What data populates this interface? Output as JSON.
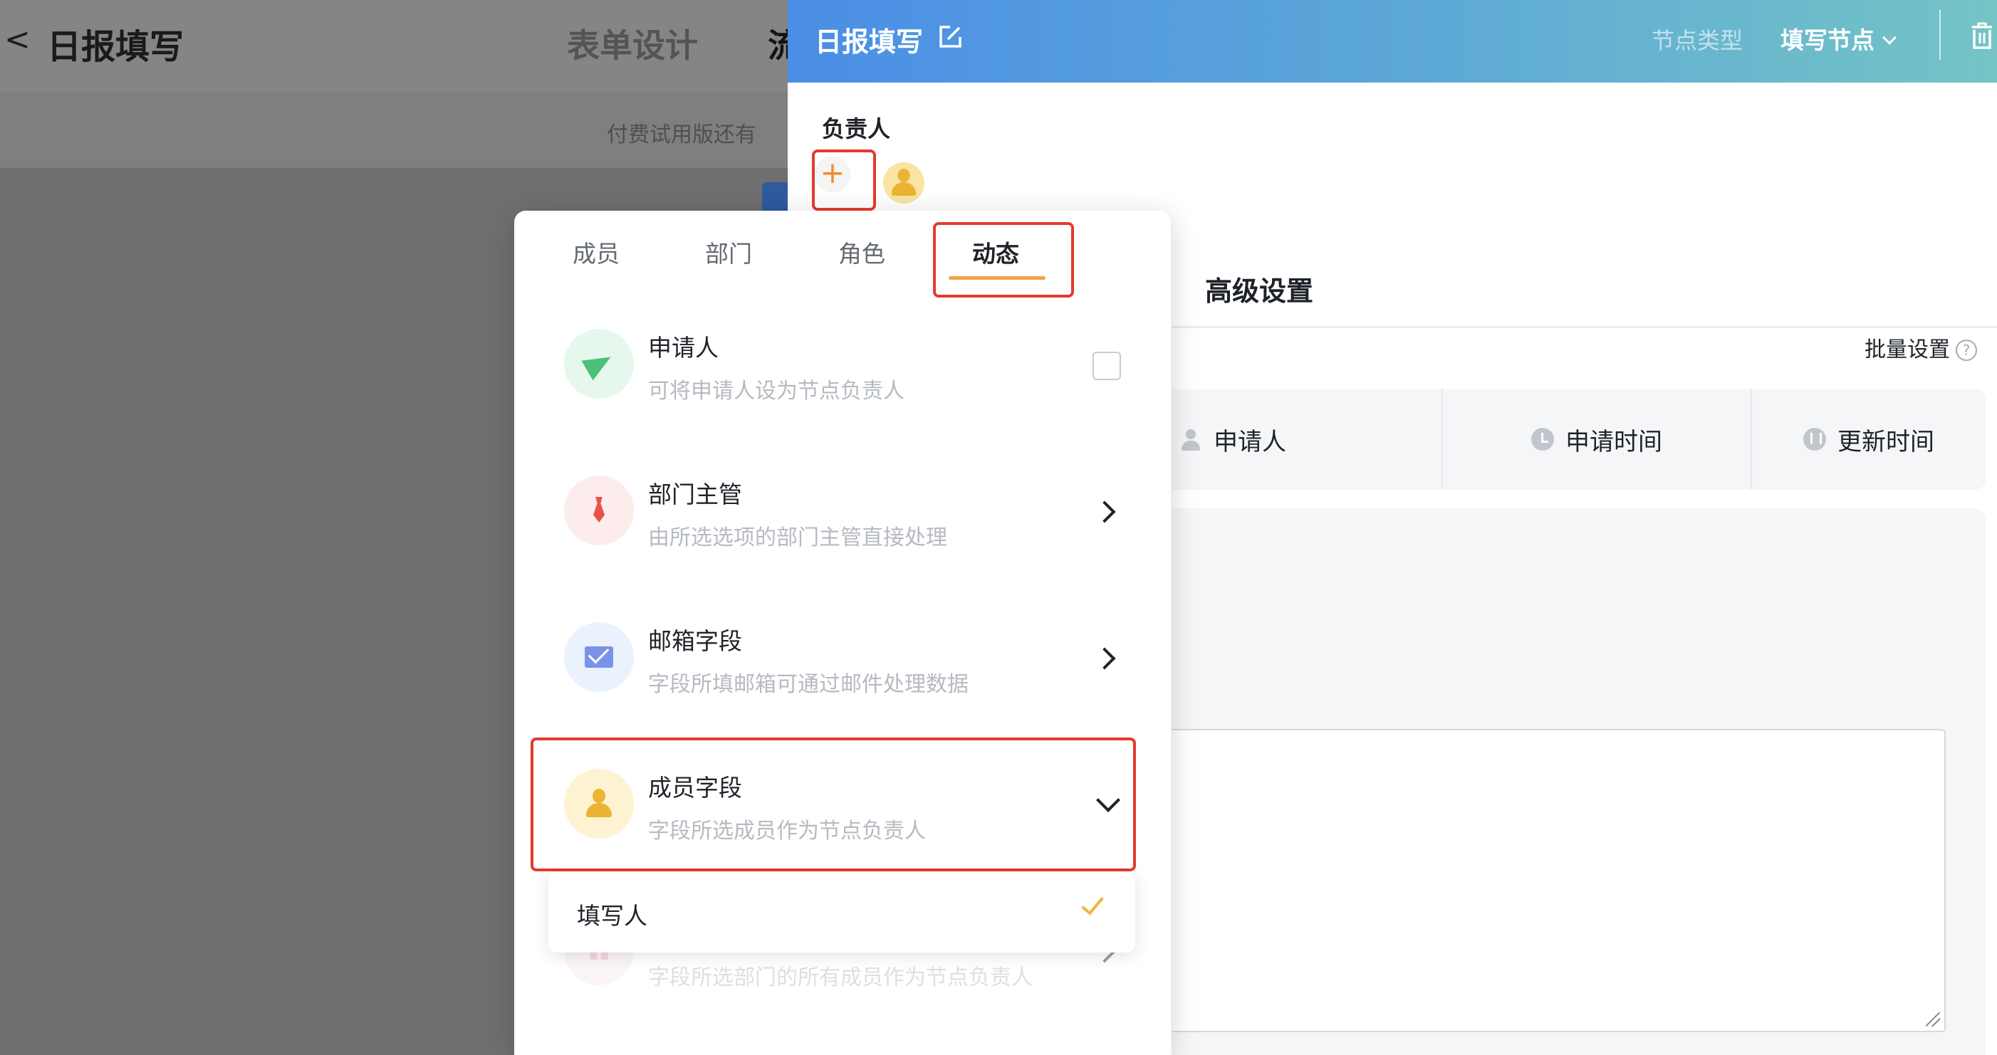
{
  "background_page": {
    "back_glyph": "<",
    "title": "日报填写",
    "tabs": [
      "表单设计",
      "流"
    ],
    "banner_text": "付费试用版还有"
  },
  "drawer": {
    "title": "日报填写",
    "node_type_label": "节点类型",
    "node_type_value": "填写节点",
    "owner_label": "负责人",
    "add_owner_glyph": "+",
    "advanced_settings": "高级设置",
    "batch_settings": "批量设置",
    "help_glyph": "?",
    "field_columns": [
      "申请人",
      "申请时间",
      "更新时间"
    ]
  },
  "picker": {
    "tabs": [
      "成员",
      "部门",
      "角色",
      "动态"
    ],
    "active_tab": "动态",
    "options": [
      {
        "title": "申请人",
        "desc": "可将申请人设为节点负责人",
        "icon": "paper-plane-icon",
        "control": "checkbox"
      },
      {
        "title": "部门主管",
        "desc": "由所选选项的部门主管直接处理",
        "icon": "tie-icon",
        "control": "chevron-right"
      },
      {
        "title": "邮箱字段",
        "desc": "字段所填邮箱可通过邮件处理数据",
        "icon": "mail-icon",
        "control": "chevron-right"
      },
      {
        "title": "成员字段",
        "desc": "字段所选成员作为节点负责人",
        "icon": "person-icon",
        "control": "chevron-down"
      },
      {
        "title": "",
        "desc": "字段所选部门的所有成员作为节点负责人",
        "icon": "department-icon",
        "control": "chevron-right"
      }
    ],
    "member_field_dropdown": {
      "options": [
        {
          "label": "填写人",
          "selected": true
        }
      ]
    }
  },
  "colors": {
    "accent_orange": "#f0a44b",
    "highlight_red": "#e33b2e",
    "header_gradient_start": "#4a8ee6",
    "header_gradient_end": "#74c4c6"
  }
}
